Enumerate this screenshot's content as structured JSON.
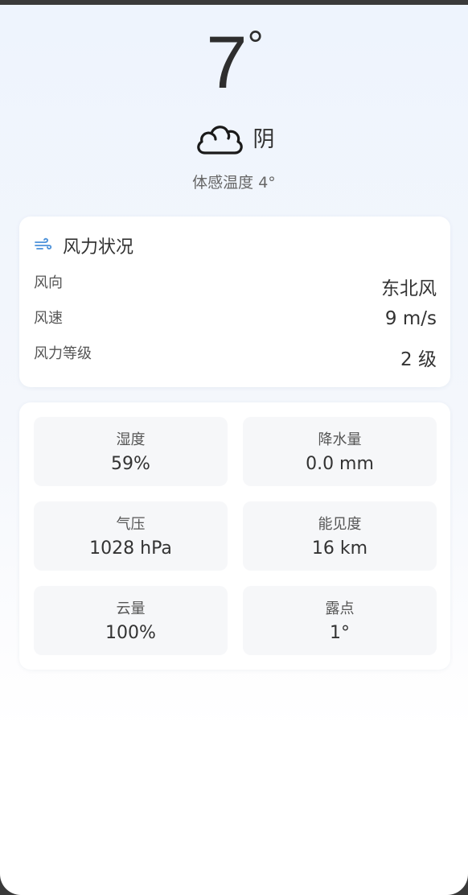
{
  "current": {
    "temperature": "7",
    "degree_symbol": "°",
    "condition": "阴",
    "condition_icon": "cloudy-icon",
    "feels_like": "体感温度 4°"
  },
  "wind": {
    "title": "风力状况",
    "icon": "wind-icon",
    "accent_color": "#4a90d9",
    "rows": [
      {
        "label": "风向",
        "value": "东北风"
      },
      {
        "label": "风速",
        "value": "9 m/s"
      },
      {
        "label": "风力等级",
        "value": "2 级"
      }
    ]
  },
  "details": [
    {
      "label": "湿度",
      "value": "59%"
    },
    {
      "label": "降水量",
      "value": "0.0 mm"
    },
    {
      "label": "气压",
      "value": "1028 hPa"
    },
    {
      "label": "能见度",
      "value": "16 km"
    },
    {
      "label": "云量",
      "value": "100%"
    },
    {
      "label": "露点",
      "value": "1°"
    }
  ]
}
